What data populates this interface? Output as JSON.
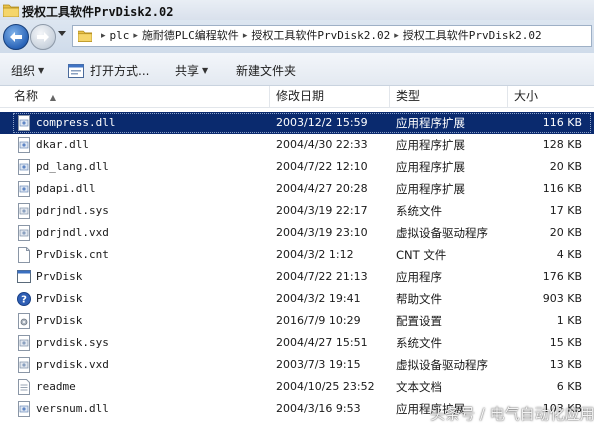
{
  "window": {
    "title": "授权工具软件PrvDisk2.02"
  },
  "address": {
    "crumbs": [
      "plc",
      "施耐德PLC编程软件",
      "授权工具软件PrvDisk2.02",
      "授权工具软件PrvDisk2.02"
    ]
  },
  "toolbar": {
    "organize": "组织",
    "open_with": "打开方式...",
    "share": "共享",
    "new_folder": "新建文件夹"
  },
  "columns": {
    "name": "名称",
    "modified": "修改日期",
    "type": "类型",
    "size": "大小"
  },
  "files": [
    {
      "name": "compress.dll",
      "modified": "2003/12/2 15:59",
      "type": "应用程序扩展",
      "size": "116 KB",
      "icon": "dll-icon",
      "selected": true
    },
    {
      "name": "dkar.dll",
      "modified": "2004/4/30 22:33",
      "type": "应用程序扩展",
      "size": "128 KB",
      "icon": "dll-icon",
      "selected": false
    },
    {
      "name": "pd_lang.dll",
      "modified": "2004/7/22 12:10",
      "type": "应用程序扩展",
      "size": "20 KB",
      "icon": "dll-icon",
      "selected": false
    },
    {
      "name": "pdapi.dll",
      "modified": "2004/4/27 20:28",
      "type": "应用程序扩展",
      "size": "116 KB",
      "icon": "dll-icon",
      "selected": false
    },
    {
      "name": "pdrjndl.sys",
      "modified": "2004/3/19 22:17",
      "type": "系统文件",
      "size": "17 KB",
      "icon": "sys-icon",
      "selected": false
    },
    {
      "name": "pdrjndl.vxd",
      "modified": "2004/3/19 23:10",
      "type": "虚拟设备驱动程序",
      "size": "20 KB",
      "icon": "vxd-icon",
      "selected": false
    },
    {
      "name": "PrvDisk.cnt",
      "modified": "2004/3/2 1:12",
      "type": "CNT 文件",
      "size": "4 KB",
      "icon": "blank-file-icon",
      "selected": false
    },
    {
      "name": "PrvDisk",
      "modified": "2004/7/22 21:13",
      "type": "应用程序",
      "size": "176 KB",
      "icon": "app-icon",
      "selected": false
    },
    {
      "name": "PrvDisk",
      "modified": "2004/3/2 19:41",
      "type": "帮助文件",
      "size": "903 KB",
      "icon": "help-icon",
      "selected": false
    },
    {
      "name": "PrvDisk",
      "modified": "2016/7/9 10:29",
      "type": "配置设置",
      "size": "1 KB",
      "icon": "config-icon",
      "selected": false
    },
    {
      "name": "prvdisk.sys",
      "modified": "2004/4/27 15:51",
      "type": "系统文件",
      "size": "15 KB",
      "icon": "sys-icon",
      "selected": false
    },
    {
      "name": "prvdisk.vxd",
      "modified": "2003/7/3 19:15",
      "type": "虚拟设备驱动程序",
      "size": "13 KB",
      "icon": "vxd-icon",
      "selected": false
    },
    {
      "name": "readme",
      "modified": "2004/10/25 23:52",
      "type": "文本文档",
      "size": "6 KB",
      "icon": "text-file-icon",
      "selected": false
    },
    {
      "name": "versnum.dll",
      "modified": "2004/3/16 9:53",
      "type": "应用程序扩展",
      "size": "103 KB",
      "icon": "dll-icon",
      "selected": false
    }
  ],
  "watermark": "头条号 / 电气自动化应用",
  "colors": {
    "selection": "#0a2a6e",
    "titlebar": "#dde6f1"
  }
}
